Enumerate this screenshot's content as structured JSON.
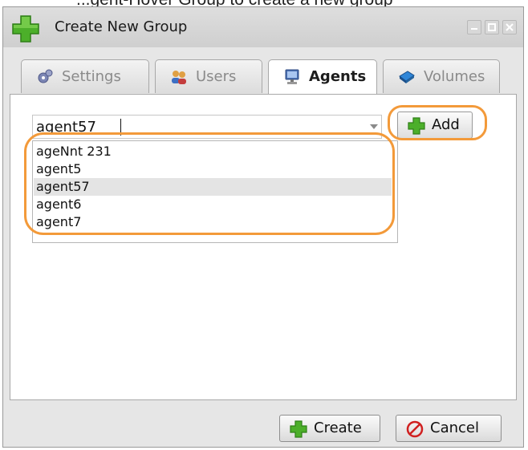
{
  "caption": "...gent-Hover Group to create a new group",
  "window": {
    "title": "Create New Group",
    "controls": [
      "minimize-icon",
      "maximize-icon",
      "close-icon"
    ]
  },
  "tabs": [
    {
      "label": "Settings",
      "icon": "gear-icon",
      "active": false
    },
    {
      "label": "Users",
      "icon": "users-icon",
      "active": false
    },
    {
      "label": "Agents",
      "icon": "computer-icon",
      "active": true
    },
    {
      "label": "Volumes",
      "icon": "volume-icon",
      "active": false
    }
  ],
  "agent_combo": {
    "value": "agent57",
    "options": [
      "ageNnt 231",
      "agent5",
      "agent57",
      "agent6",
      "agent7"
    ],
    "selected_index": 2
  },
  "add_button": {
    "label": "Add",
    "icon": "plus-icon"
  },
  "footer": {
    "create_label": "Create",
    "cancel_label": "Cancel"
  },
  "colors": {
    "highlight_ring": "#f39a3a",
    "plus_green": "#4caf2a"
  }
}
